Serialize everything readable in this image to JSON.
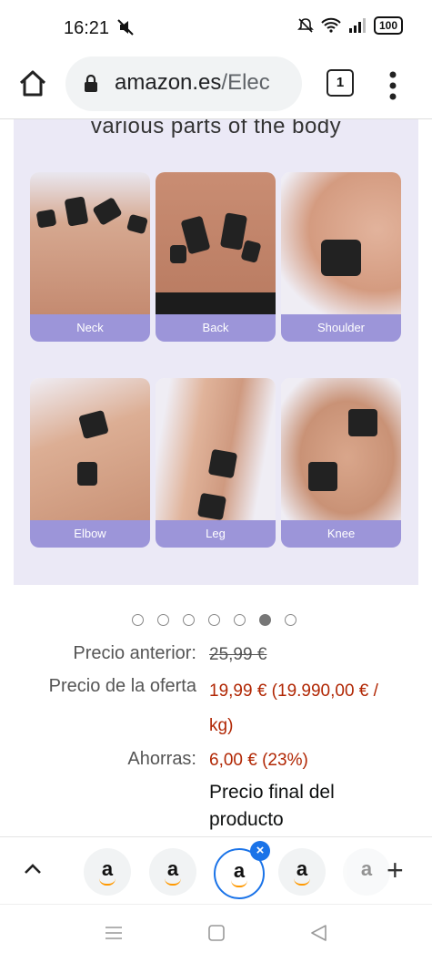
{
  "status_bar": {
    "time": "16:21",
    "battery": "100"
  },
  "browser": {
    "url_domain": "amazon.es",
    "url_path": "/Elec",
    "tab_count": "1"
  },
  "product_image": {
    "heading": "various parts of the body",
    "tiles": [
      "Neck",
      "Back",
      "Shoulder",
      "Elbow",
      "Leg",
      "Knee"
    ]
  },
  "carousel": {
    "total": 7,
    "active_index": 5
  },
  "pricing": {
    "previous_label": "Precio anterior:",
    "previous_value": "25,99 €",
    "offer_label": "Precio de la oferta",
    "offer_value_line1": "19,99 € (19.990,00 € /",
    "offer_value_line2": "kg)",
    "savings_label": "Ahorras:",
    "savings_value": "6,00 € (23%)",
    "final_line1": "Precio final del",
    "final_line2": "producto"
  },
  "tab_strip": {
    "tab_letters": [
      "a",
      "a",
      "a",
      "a",
      "a"
    ],
    "add_label": "+"
  },
  "colors": {
    "price_red": "#b12704",
    "label_purple": "#9c95d9",
    "active_tab_blue": "#1a73e8"
  }
}
